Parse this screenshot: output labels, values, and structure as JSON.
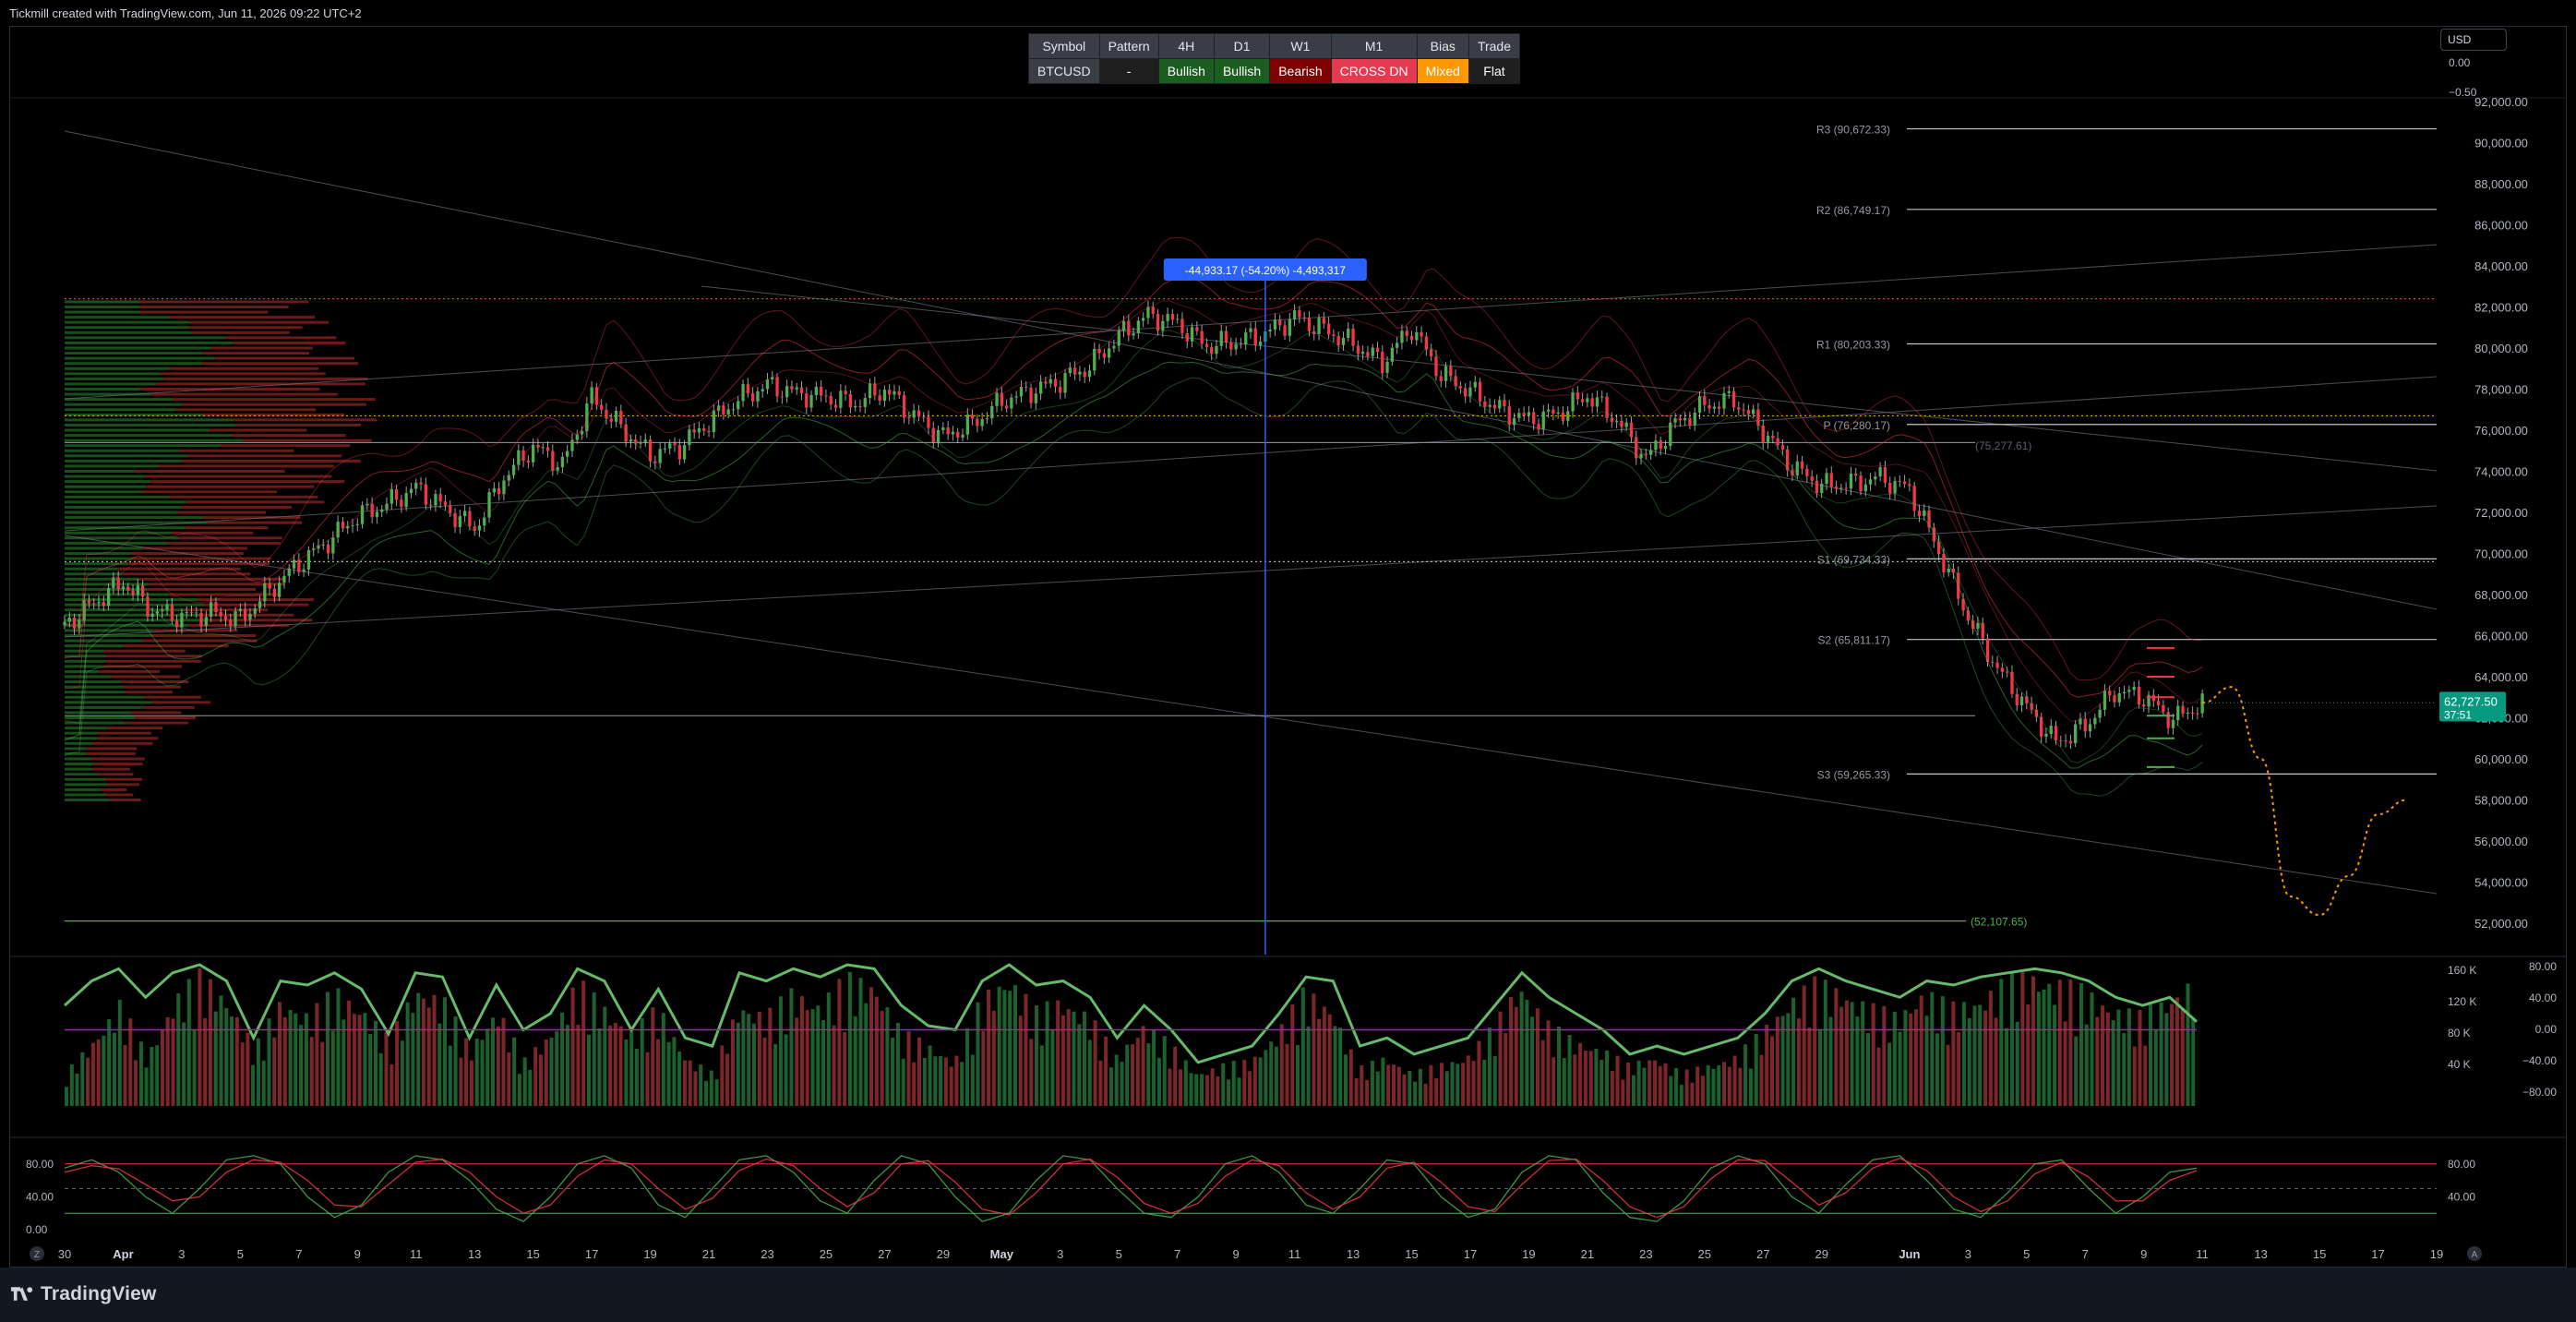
{
  "window": {
    "caption": "Tickmill created with TradingView.com, Jun 11, 2026 09:22 UTC+2",
    "currency_label": "USD",
    "brand": "TradingView",
    "time_button_left": "Z",
    "time_button_right": "A"
  },
  "signal_table": {
    "headers": [
      "Symbol",
      "Pattern",
      "4H",
      "D1",
      "W1",
      "M1",
      "Bias",
      "Trade"
    ],
    "values": [
      "BTCUSD",
      "-",
      "Bullish",
      "Bullish",
      "Bearish",
      "CROSS DN",
      "Mixed",
      "Flat"
    ],
    "colors": [
      "#3a3d45",
      "#1e1e1e",
      "#1b5e20",
      "#1b5e20",
      "#7f0000",
      "#e53950",
      "#ff9800",
      "#1e1e1e"
    ]
  },
  "colors": {
    "up": "#4caf50",
    "down": "#f23645",
    "accent": "#2962ff",
    "last_price_bg": "#089981",
    "forecast": "#ff9800",
    "muted": "#787b86"
  },
  "chart_data": [
    {
      "type": "candlestick",
      "title": "",
      "symbol": "BTCUSD",
      "timeframe": "4H",
      "x_range": [
        "2026-03-30",
        "2026-06-19"
      ],
      "x_ticks": [
        "30",
        "Apr",
        "3",
        "5",
        "7",
        "9",
        "11",
        "13",
        "15",
        "17",
        "19",
        "21",
        "23",
        "25",
        "27",
        "29",
        "May",
        "3",
        "5",
        "7",
        "9",
        "11",
        "13",
        "15",
        "17",
        "19",
        "21",
        "23",
        "25",
        "27",
        "29",
        "Jun",
        "3",
        "5",
        "7",
        "9",
        "11",
        "13",
        "15",
        "17",
        "19"
      ],
      "ylim": [
        51000,
        93000
      ],
      "y_ticks": [
        52000,
        54000,
        56000,
        58000,
        60000,
        62000,
        64000,
        66000,
        68000,
        70000,
        72000,
        74000,
        76000,
        78000,
        80000,
        82000,
        84000,
        86000,
        88000,
        90000,
        92000
      ],
      "y_tick_labels": [
        "52,000.00",
        "54,000.00",
        "56,000.00",
        "58,000.00",
        "60,000.00",
        "62,000.00",
        "64,000.00",
        "66,000.00",
        "68,000.00",
        "70,000.00",
        "72,000.00",
        "74,000.00",
        "76,000.00",
        "78,000.00",
        "80,000.00",
        "82,000.00",
        "84,000.00",
        "86,000.00",
        "88,000.00",
        "90,000.00",
        "92,000.00"
      ],
      "last_price": 62727.5,
      "last_price_label": "62,727.50",
      "countdown_label": "37:51",
      "price_path": [
        [
          "2026-03-30",
          66500
        ],
        [
          "2026-03-31",
          67600
        ],
        [
          "2026-04-01",
          68600
        ],
        [
          "2026-04-02",
          67200
        ],
        [
          "2026-04-03",
          66900
        ],
        [
          "2026-04-04",
          67100
        ],
        [
          "2026-04-05",
          66800
        ],
        [
          "2026-04-06",
          68200
        ],
        [
          "2026-04-07",
          69500
        ],
        [
          "2026-04-08",
          70600
        ],
        [
          "2026-04-09",
          71800
        ],
        [
          "2026-04-10",
          72400
        ],
        [
          "2026-04-11",
          73200
        ],
        [
          "2026-04-12",
          72200
        ],
        [
          "2026-04-13",
          71200
        ],
        [
          "2026-04-14",
          73700
        ],
        [
          "2026-04-15",
          75200
        ],
        [
          "2026-04-16",
          74300
        ],
        [
          "2026-04-17",
          77600
        ],
        [
          "2026-04-18",
          76100
        ],
        [
          "2026-04-19",
          74800
        ],
        [
          "2026-04-20",
          75200
        ],
        [
          "2026-04-21",
          76400
        ],
        [
          "2026-04-22",
          77500
        ],
        [
          "2026-04-23",
          78200
        ],
        [
          "2026-04-24",
          77800
        ],
        [
          "2026-04-25",
          77600
        ],
        [
          "2026-04-26",
          77300
        ],
        [
          "2026-04-27",
          78000
        ],
        [
          "2026-04-28",
          76700
        ],
        [
          "2026-04-29",
          75700
        ],
        [
          "2026-04-30",
          76300
        ],
        [
          "2026-05-01",
          77400
        ],
        [
          "2026-05-02",
          77900
        ],
        [
          "2026-05-03",
          78400
        ],
        [
          "2026-05-04",
          79100
        ],
        [
          "2026-05-05",
          80600
        ],
        [
          "2026-05-06",
          81600
        ],
        [
          "2026-05-07",
          81200
        ],
        [
          "2026-05-08",
          80100
        ],
        [
          "2026-05-09",
          80300
        ],
        [
          "2026-05-10",
          80700
        ],
        [
          "2026-05-11",
          81500
        ],
        [
          "2026-05-12",
          80900
        ],
        [
          "2026-05-13",
          80200
        ],
        [
          "2026-05-14",
          79300
        ],
        [
          "2026-05-15",
          81000
        ],
        [
          "2026-05-16",
          78700
        ],
        [
          "2026-05-17",
          77900
        ],
        [
          "2026-05-18",
          77000
        ],
        [
          "2026-05-19",
          76500
        ],
        [
          "2026-05-20",
          76800
        ],
        [
          "2026-05-21",
          77700
        ],
        [
          "2026-05-22",
          76500
        ],
        [
          "2026-05-23",
          74600
        ],
        [
          "2026-05-24",
          76300
        ],
        [
          "2026-05-25",
          77200
        ],
        [
          "2026-05-26",
          77500
        ],
        [
          "2026-05-27",
          76000
        ],
        [
          "2026-05-28",
          74200
        ],
        [
          "2026-05-29",
          73300
        ],
        [
          "2026-05-30",
          73400
        ],
        [
          "2026-05-31",
          73700
        ],
        [
          "2026-06-01",
          73100
        ],
        [
          "2026-06-02",
          70100
        ],
        [
          "2026-06-03",
          66900
        ],
        [
          "2026-06-04",
          64400
        ],
        [
          "2026-06-05",
          62500
        ],
        [
          "2026-06-06",
          60800
        ],
        [
          "2026-06-07",
          61600
        ],
        [
          "2026-06-08",
          63300
        ],
        [
          "2026-06-09",
          63000
        ],
        [
          "2026-06-10",
          61900
        ],
        [
          "2026-06-11",
          62727.5
        ]
      ],
      "forecast_path": [
        [
          "2026-06-11",
          62727.5
        ],
        [
          "2026-06-12",
          63500
        ],
        [
          "2026-06-13",
          60000
        ],
        [
          "2026-06-14",
          53300
        ],
        [
          "2026-06-15",
          52400
        ],
        [
          "2026-06-16",
          54300
        ],
        [
          "2026-06-17",
          57300
        ],
        [
          "2026-06-18",
          58000
        ]
      ],
      "horizontal_levels": [
        {
          "label": "R3 (90,672.33)",
          "value": 90672.33
        },
        {
          "label": "R2 (86,749.17)",
          "value": 86749.17
        },
        {
          "label": "R1 (80,203.33)",
          "value": 80203.33
        },
        {
          "label": "P (76,280.17)",
          "value": 76280.17
        },
        {
          "label": "S1 (69,734.33)",
          "value": 69734.33
        },
        {
          "label": "S2 (65,811.17)",
          "value": 65811.17
        },
        {
          "label": "S3 (59,265.33)",
          "value": 59265.33
        },
        {
          "label": "(52,107.65)",
          "value": 52107.65
        },
        {
          "label": "(75,277.61)",
          "value": 75277.61
        }
      ],
      "measure_label": "-44,933.17 (-54.20%) -4,493,317",
      "volume_profile": "left",
      "grid": false,
      "legend": "none"
    },
    {
      "type": "bar",
      "title": "",
      "y_ticks_left": [
        "160 K",
        "120 K",
        "80 K",
        "40 K"
      ],
      "y_ticks_right": [
        "80.00",
        "40.00",
        "0.00",
        "−40.00",
        "−80.00"
      ],
      "series": [
        {
          "values": [
            40,
            80,
            125,
            60,
            130,
            160,
            130,
            70,
            130,
            110,
            140,
            120,
            80,
            145,
            130,
            70,
            120,
            55,
            90,
            150,
            120,
            90,
            120,
            60,
            40,
            125,
            110,
            140,
            125,
            155,
            150,
            90,
            75,
            55,
            130,
            160,
            115,
            130,
            110,
            60,
            100,
            75,
            40,
            50,
            55,
            90,
            140,
            120,
            45,
            60,
            40,
            50,
            60,
            95,
            150,
            100,
            80,
            70,
            50,
            60,
            40,
            50,
            60,
            90,
            130,
            150,
            140,
            120,
            110,
            140,
            120,
            130,
            150,
            160,
            150,
            140,
            120,
            110,
            130,
            150
          ]
        }
      ],
      "oscillator_line": [
        30,
        60,
        75,
        40,
        70,
        80,
        60,
        -10,
        60,
        55,
        70,
        50,
        -5,
        70,
        65,
        -10,
        55,
        0,
        20,
        75,
        60,
        0,
        50,
        -10,
        -20,
        70,
        60,
        75,
        65,
        80,
        75,
        30,
        5,
        0,
        60,
        80,
        55,
        60,
        40,
        -10,
        30,
        0,
        -40,
        -30,
        -20,
        20,
        65,
        60,
        -20,
        -10,
        -30,
        -20,
        -10,
        30,
        70,
        40,
        20,
        0,
        -30,
        -20,
        -30,
        -20,
        -10,
        20,
        60,
        75,
        60,
        50,
        40,
        60,
        55,
        65,
        70,
        75,
        70,
        60,
        40,
        30,
        40,
        10
      ]
    },
    {
      "type": "line",
      "title": "",
      "ylim": [
        0,
        100
      ],
      "y_ticks": [
        80,
        40,
        0
      ],
      "y_tick_labels_left": [
        "80.00",
        "40.00",
        "0.00"
      ],
      "y_tick_labels_right": [
        "80.00",
        "40.00"
      ],
      "upper_band": 80,
      "lower_band": 20,
      "series": [
        {
          "values": [
            75,
            85,
            70,
            40,
            20,
            50,
            85,
            90,
            80,
            40,
            15,
            30,
            70,
            90,
            85,
            60,
            25,
            10,
            40,
            80,
            90,
            75,
            30,
            15,
            50,
            85,
            90,
            70,
            35,
            20,
            60,
            90,
            80,
            40,
            10,
            20,
            60,
            90,
            85,
            50,
            20,
            15,
            40,
            80,
            90,
            70,
            30,
            20,
            50,
            85,
            80,
            40,
            15,
            25,
            70,
            90,
            85,
            45,
            15,
            10,
            35,
            75,
            90,
            80,
            40,
            20,
            55,
            85,
            90,
            60,
            25,
            15,
            45,
            80,
            85,
            50,
            20,
            40,
            70,
            75
          ]
        },
        {
          "values": [
            70,
            78,
            74,
            55,
            35,
            40,
            70,
            85,
            82,
            60,
            30,
            28,
            55,
            82,
            86,
            70,
            40,
            20,
            30,
            65,
            85,
            80,
            50,
            25,
            38,
            72,
            86,
            78,
            50,
            28,
            45,
            80,
            84,
            58,
            25,
            18,
            45,
            80,
            86,
            64,
            32,
            20,
            32,
            65,
            85,
            78,
            45,
            25,
            40,
            75,
            82,
            58,
            28,
            22,
            55,
            84,
            86,
            60,
            28,
            15,
            28,
            62,
            85,
            84,
            58,
            30,
            45,
            75,
            87,
            72,
            40,
            22,
            35,
            68,
            82,
            64,
            35,
            35,
            60,
            72
          ]
        }
      ]
    }
  ]
}
